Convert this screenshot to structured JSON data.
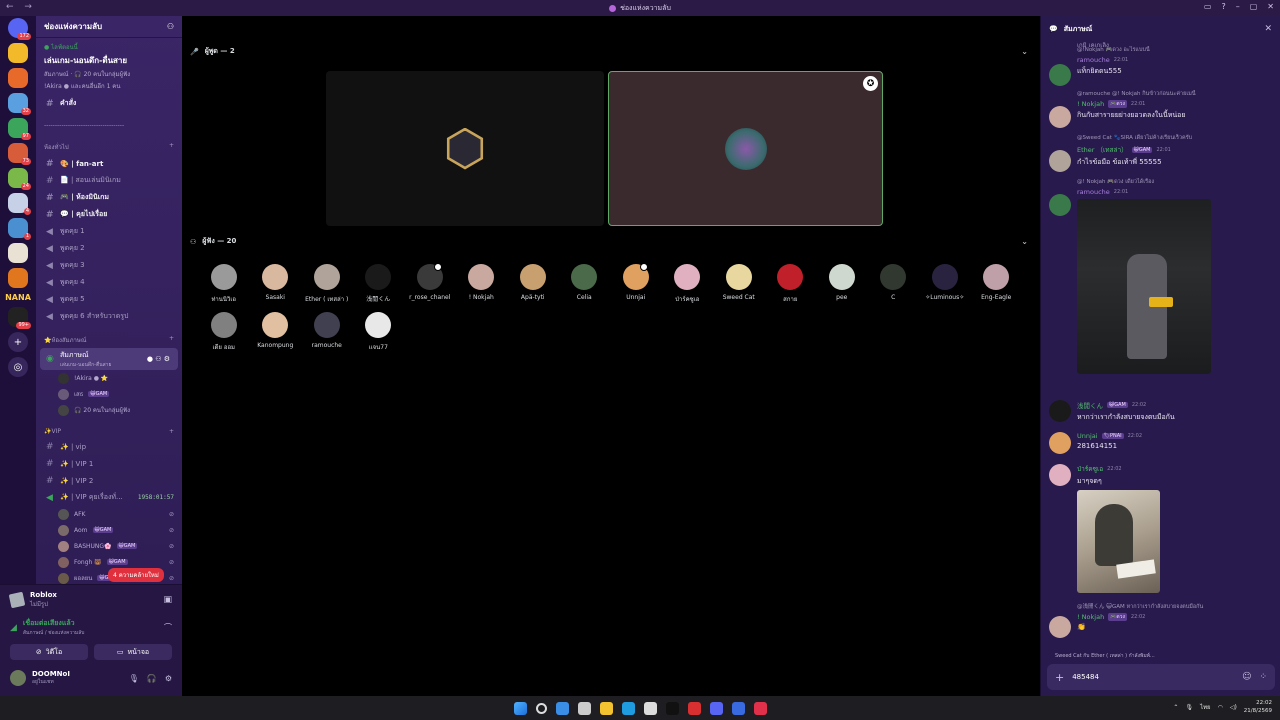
{
  "window": {
    "title": "ช่องแห่งความลับ",
    "nav_arrows": "← →",
    "controls": [
      "▭",
      "?",
      "–",
      "▢",
      "✕"
    ]
  },
  "servers": [
    {
      "color": "#5865f2",
      "badge": "172"
    },
    {
      "color": "#f2b92a",
      "badge": ""
    },
    {
      "color": "#e86a2a",
      "badge": ""
    },
    {
      "color": "#5aa0e0",
      "badge": "32"
    },
    {
      "color": "#3ba55c",
      "badge": "97"
    },
    {
      "color": "#d65c3a",
      "badge": "73"
    },
    {
      "color": "#7ab84a",
      "badge": "24"
    },
    {
      "color": "#c6d0e6",
      "badge": "4"
    },
    {
      "color": "#4a8fd0",
      "badge": "1"
    },
    {
      "color": "#e9e2d4",
      "badge": ""
    },
    {
      "color": "#e0761d",
      "badge": ""
    },
    {
      "color": "#222",
      "badge": "99+"
    }
  ],
  "servers_brand_text": "NANA",
  "sidebar": {
    "server_name": "ช่องแห่งความลับ",
    "event": {
      "live": "● ไลฟ์ตอนนี้",
      "name": "เล่นเกม-นอนดึก-ตื่นสาย",
      "sub1": "สัมภาษณ์ · 🎧 20 คนในกลุ่มผู้ฟัง",
      "sub2": "!Akira ● และคนอื่นอีก 1 คน"
    },
    "command_channel": "คำสั่ง",
    "divider": "-------------------------------------",
    "general_category": "ห้องทั่วไป",
    "general_channels": [
      {
        "label": "🎨 | fan-art",
        "unread": true
      },
      {
        "label": "📄 | สอนเล่นมินิเกม",
        "unread": false
      },
      {
        "label": "🎮 | ห้องมินิเกม",
        "unread": true
      },
      {
        "label": "💬 | คุยไปเรื่อย",
        "unread": true
      }
    ],
    "voice_channels": [
      "พูดคุย 1",
      "พูดคุย 2",
      "พูดคุย 3",
      "พูดคุย 4",
      "พูดคุย 5",
      "พูดคุย 6 สำหรับวาดรูป"
    ],
    "stage_category": "⭐ห้องสัมภาษณ์",
    "stage_channel": {
      "name": "สัมภาษณ์",
      "topic": "เล่นเกม-นอนดึก-ตื่นสาย"
    },
    "stage_users": [
      {
        "name": "!Akira ● ⭐",
        "tag": ""
      },
      {
        "name": "เสธ",
        "tag": "😺GAM"
      },
      {
        "name": "🎧 20 คนในกลุ่มผู้ฟัง",
        "tag": ""
      }
    ],
    "vip_category": "✨VIP",
    "vip_channels": [
      "✨ | vip",
      "✨ | VIP 1",
      "✨ | VIP 2"
    ],
    "vip_voice": {
      "name": "✨ | VIP คุยเรื่องทั่...",
      "timer": "1958:01:57"
    },
    "vip_voice_users": [
      {
        "name": "AFK",
        "tag": ""
      },
      {
        "name": "Aom",
        "tag": "😺GAM"
      },
      {
        "name": "BASHUNG🌸",
        "tag": "😺GAM"
      },
      {
        "name": "Fongh 🐻 ",
        "tag": "😺GAM"
      },
      {
        "name": "ผอลยน",
        "tag": "😺GAM"
      }
    ],
    "toast": "4 ความคล้ายใหม่"
  },
  "panel": {
    "activity_title": "Roblox",
    "activity_sub": "ไม่มีรูป",
    "voice_title": "เชื่อมต่อเสียงแล้ว",
    "voice_sub": "สัมภาษณ์ / ช่องแห่งความลับ",
    "video_label": "วิดีโอ",
    "screen_label": "หน้าจอ",
    "user_name": "DOOMNoI",
    "user_status": "อยู่ในแชท"
  },
  "stage": {
    "speakers_header": "ผู้พูด — 2",
    "audience_header": "ผู้ฟัง — 20",
    "audience": [
      {
        "name": "ท่านนิวิเอ",
        "color": "#9a9a9a"
      },
      {
        "name": "Sasaki",
        "color": "#d9b8a0"
      },
      {
        "name": "Ether ( เทสล่า )",
        "color": "#b0a49a"
      },
      {
        "name": "浅閒くん",
        "color": "#1a1a1a"
      },
      {
        "name": "r_rose_chanel",
        "color": "#3a3a3a",
        "gear": true
      },
      {
        "name": "! Nokjah",
        "color": "#c9a8a0"
      },
      {
        "name": "Apä-tyti",
        "color": "#c8a070"
      },
      {
        "name": "Celia",
        "color": "#4a6a4a"
      },
      {
        "name": "Unnjai",
        "color": "#e0a060",
        "gear": true
      },
      {
        "name": "ป่าร์คซูเอ",
        "color": "#e0b0c0"
      },
      {
        "name": "Sweed Cat",
        "color": "#e8d8a0"
      },
      {
        "name": "สกาย",
        "color": "#c0202a"
      },
      {
        "name": "pee",
        "color": "#cfd8cf"
      },
      {
        "name": "C",
        "color": "#303830"
      },
      {
        "name": "✧Luminous✧",
        "color": "#2a2340"
      },
      {
        "name": "Eng-Eagle",
        "color": "#c0a0a8"
      },
      {
        "name": "เดีย ออม",
        "color": "#808080"
      },
      {
        "name": "Kanompung",
        "color": "#e0c0a0"
      },
      {
        "name": "ramouche",
        "color": "#404050"
      },
      {
        "name": "เเจน77",
        "color": "#e8e8e8"
      }
    ]
  },
  "chat": {
    "title": "สัมภาษณ์",
    "messages": [
      {
        "reply": "@!Nokjah 🎮ดวง อะไรแบบนี้",
        "user": "ramouche",
        "user_color": "#a77de0",
        "time": "22:01",
        "text": "แท็กยิดดน555",
        "av": "#3a7a4a"
      },
      {
        "reply": "@ramouche @! Nokjah กินข้าวก่อนนะค่ายเมนี้",
        "user": "! Nokjah",
        "user_color": "#4fbf6c",
        "time": "22:01",
        "text": "กินกับสารายยย่างยอวดลงในนี้หน่อย",
        "av": "#c9a8a0"
      },
      {
        "reply": "@Sweed Cat 🐾SIRA เดี๋ยวไม่ค้างเรียนเร็วครับ",
        "user": "Ether （เทสล่า）",
        "user_color": "#4fbf6c",
        "time": "22:01",
        "text": "กำไรข้อมือ ข้อเท้าพี่ 55555",
        "av": "#b0a49a"
      },
      {
        "reply": "@! Nokjah 🎮ดวง เดี๋ยวได้เรื่อง",
        "user": "ramouche",
        "user_color": "#a77de0",
        "time": "22:01",
        "text": "",
        "av": "#3a7a4a"
      },
      {
        "reply": "",
        "user": "浅閒くん",
        "user_color": "#4fbf6c",
        "time": "22:02",
        "text": "หากว่าเรากำลังสบายจงตบมือกัน",
        "av": "#1a1a1a"
      },
      {
        "reply": "",
        "user": "Unnjai",
        "user_color": "#4fbf6c",
        "time": "22:02",
        "text": "281614151",
        "av": "#e0a060"
      },
      {
        "reply": "",
        "user": "ป่าร์คซูเอ",
        "user_color": "#4fbf6c",
        "time": "22:02",
        "text": "มาๆจดๆ",
        "av": "#e0b0c0"
      },
      {
        "reply": "@浅閒くん 😺GAM หากว่าเรากำลังสบายจงตบมือกัน",
        "user": "! Nokjah",
        "user_color": "#4fbf6c",
        "time": "22:02",
        "text": "👏",
        "av": "#c9a8a0"
      }
    ],
    "tags": {
      "m0": "🎮ดวง",
      "m1": "🎮ดวง",
      "m2": "😺GAM",
      "m4": "😺GAM",
      "m5": "🏷PNAI",
      "m7": "🎮ดวง"
    },
    "typing": "Sweed Cat กับ Ether ( เทสล่า ) กำลังพิมพ์...",
    "input_value": "485484",
    "header_cut": "เกมิ เคเกเลิง"
  },
  "taskbar": {
    "icons": [
      "#3a8ee6",
      "#cccccc",
      "#f2c230",
      "#1f9be0",
      "#dcdcdc",
      "#111111",
      "#d83030",
      "#5865f2",
      "#3a6ae0",
      "#e0304a"
    ],
    "time": "22:02",
    "date": "21/8/2569"
  }
}
